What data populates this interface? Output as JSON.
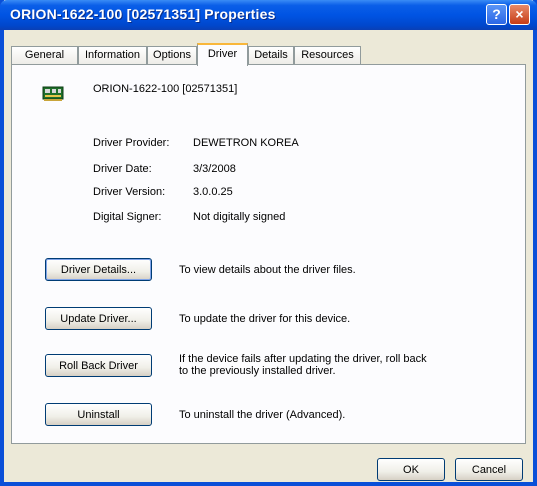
{
  "window": {
    "title": "ORION-1622-100 [02571351] Properties",
    "help": "?",
    "close": "×"
  },
  "tabs": [
    "General",
    "Information",
    "Options",
    "Driver",
    "Details",
    "Resources"
  ],
  "device": {
    "name": "ORION-1622-100 [02571351]"
  },
  "info": [
    {
      "label": "Driver Provider:",
      "value": "DEWETRON KOREA"
    },
    {
      "label": "Driver Date:",
      "value": "3/3/2008"
    },
    {
      "label": "Driver Version:",
      "value": "3.0.0.25"
    },
    {
      "label": "Digital Signer:",
      "value": "Not digitally signed"
    }
  ],
  "actions": [
    {
      "label": "Driver Details...",
      "desc": "To view details about the driver files."
    },
    {
      "label": "Update Driver...",
      "desc": "To update the driver for this device."
    },
    {
      "label": "Roll Back Driver",
      "desc": "If the device fails after updating the driver, roll back to the previously installed driver."
    },
    {
      "label": "Uninstall",
      "desc": "To uninstall the driver (Advanced)."
    }
  ],
  "footer": {
    "ok": "OK",
    "cancel": "Cancel"
  },
  "colors": {
    "titlebar": "#0054e3",
    "face": "#ece9d8",
    "activeTabAccent": "#f9b73a"
  }
}
